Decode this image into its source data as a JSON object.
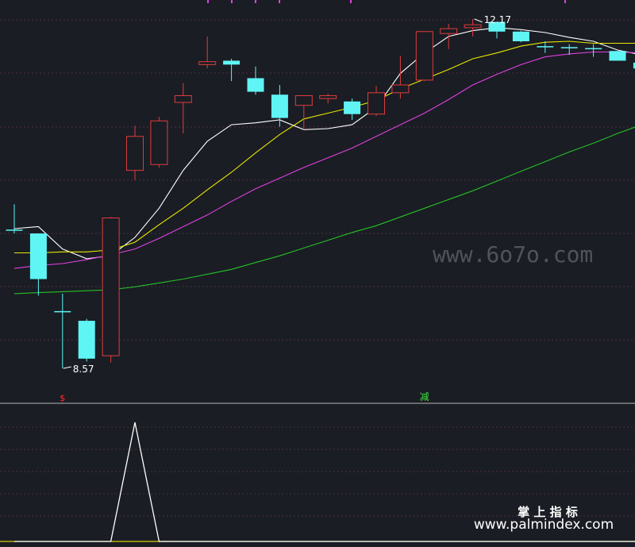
{
  "chart_data": [
    {
      "type": "candlestick",
      "ylim": [
        8.3,
        12.3
      ],
      "grid": "dotted horizontal",
      "candles": [
        {
          "o": 10.0,
          "h": 10.26,
          "l": 9.96,
          "c": 10.0,
          "dir": "flat"
        },
        {
          "o": 9.96,
          "h": 9.96,
          "l": 9.32,
          "c": 9.49,
          "dir": "down"
        },
        {
          "o": 9.16,
          "h": 9.34,
          "l": 8.57,
          "c": 9.16,
          "dir": "flat"
        },
        {
          "o": 9.06,
          "h": 9.08,
          "l": 8.64,
          "c": 8.67,
          "dir": "down"
        },
        {
          "o": 8.7,
          "h": 10.13,
          "l": 8.63,
          "c": 10.12,
          "dir": "up"
        },
        {
          "o": 10.61,
          "h": 11.07,
          "l": 10.51,
          "c": 10.96,
          "dir": "up"
        },
        {
          "o": 10.67,
          "h": 11.16,
          "l": 10.64,
          "c": 11.12,
          "dir": "up"
        },
        {
          "o": 11.31,
          "h": 11.51,
          "l": 10.99,
          "c": 11.38,
          "dir": "up"
        },
        {
          "o": 11.7,
          "h": 11.99,
          "l": 11.66,
          "c": 11.73,
          "dir": "up"
        },
        {
          "o": 11.74,
          "h": 11.76,
          "l": 11.53,
          "c": 11.7,
          "dir": "down"
        },
        {
          "o": 11.56,
          "h": 11.68,
          "l": 11.39,
          "c": 11.42,
          "dir": "down"
        },
        {
          "o": 11.39,
          "h": 11.49,
          "l": 11.06,
          "c": 11.15,
          "dir": "down"
        },
        {
          "o": 11.28,
          "h": 11.38,
          "l": 11.03,
          "c": 11.38,
          "dir": "up"
        },
        {
          "o": 11.35,
          "h": 11.4,
          "l": 11.3,
          "c": 11.38,
          "dir": "up"
        },
        {
          "o": 11.32,
          "h": 11.35,
          "l": 11.13,
          "c": 11.19,
          "dir": "down"
        },
        {
          "o": 11.19,
          "h": 11.48,
          "l": 11.17,
          "c": 11.41,
          "dir": "up"
        },
        {
          "o": 11.41,
          "h": 11.79,
          "l": 11.35,
          "c": 11.49,
          "dir": "up"
        },
        {
          "o": 11.54,
          "h": 12.04,
          "l": 11.53,
          "c": 12.04,
          "dir": "up"
        },
        {
          "o": 12.02,
          "h": 12.12,
          "l": 11.86,
          "c": 12.07,
          "dir": "up"
        },
        {
          "o": 12.08,
          "h": 12.17,
          "l": 11.99,
          "c": 12.11,
          "dir": "up"
        },
        {
          "o": 12.14,
          "h": 12.14,
          "l": 11.97,
          "c": 12.04,
          "dir": "down"
        },
        {
          "o": 12.04,
          "h": 12.05,
          "l": 11.93,
          "c": 11.94,
          "dir": "down"
        },
        {
          "o": 11.89,
          "h": 11.94,
          "l": 11.82,
          "c": 11.88,
          "dir": "flat"
        },
        {
          "o": 11.88,
          "h": 11.91,
          "l": 11.8,
          "c": 11.88,
          "dir": "flat"
        },
        {
          "o": 11.87,
          "h": 11.91,
          "l": 11.78,
          "c": 11.87,
          "dir": "down"
        },
        {
          "o": 11.84,
          "h": 11.84,
          "l": 11.74,
          "c": 11.74,
          "dir": "down"
        },
        {
          "o": 11.72,
          "h": 11.72,
          "l": 11.65,
          "c": 11.66,
          "dir": "down"
        }
      ],
      "moving_averages": [
        {
          "color": "#ffffff",
          "values": [
            10.01,
            10.03,
            9.8,
            9.7,
            9.73,
            9.92,
            10.22,
            10.61,
            10.91,
            11.08,
            11.1,
            11.13,
            11.03,
            11.04,
            11.08,
            11.26,
            11.61,
            11.82,
            11.99,
            12.05,
            12.08,
            12.06,
            12.03,
            11.98,
            11.94,
            11.85,
            11.8
          ]
        },
        {
          "color": "#e8e800",
          "values": [
            9.76,
            9.76,
            9.77,
            9.77,
            9.79,
            9.87,
            10.05,
            10.22,
            10.41,
            10.59,
            10.79,
            10.98,
            11.14,
            11.2,
            11.26,
            11.33,
            11.45,
            11.55,
            11.65,
            11.76,
            11.82,
            11.89,
            11.93,
            11.94,
            11.92,
            11.92,
            11.92
          ]
        },
        {
          "color": "#e040e0",
          "values": [
            9.6,
            9.63,
            9.65,
            9.69,
            9.74,
            9.8,
            9.91,
            10.03,
            10.15,
            10.29,
            10.42,
            10.53,
            10.64,
            10.74,
            10.84,
            10.96,
            11.08,
            11.2,
            11.34,
            11.49,
            11.6,
            11.7,
            11.78,
            11.81,
            11.83,
            11.83,
            11.82
          ]
        },
        {
          "color": "#26c026",
          "values": [
            9.34,
            9.35,
            9.36,
            9.37,
            9.38,
            9.41,
            9.45,
            9.49,
            9.54,
            9.59,
            9.66,
            9.73,
            9.81,
            9.89,
            9.97,
            10.04,
            10.13,
            10.22,
            10.31,
            10.4,
            10.5,
            10.6,
            10.7,
            10.8,
            10.89,
            10.99,
            11.08
          ]
        }
      ],
      "annotations": [
        {
          "text": "12.17",
          "candle": 19,
          "value": 12.17
        },
        {
          "text": "8.57",
          "candle": 2,
          "value": 8.57
        }
      ],
      "signals": [
        {
          "text": "$",
          "candle": 2,
          "color": "#ff3030"
        },
        {
          "text": "减",
          "candle": 17,
          "color": "#40e040"
        }
      ]
    },
    {
      "type": "line",
      "ylim": [
        0,
        1
      ],
      "series": [
        {
          "color": "#ffffff",
          "values": [
            0,
            0,
            0,
            0,
            0,
            1,
            0,
            0,
            0,
            0,
            0,
            0,
            0,
            0,
            0,
            0,
            0,
            0,
            0,
            0,
            0,
            0,
            0,
            0,
            0,
            0,
            0
          ]
        }
      ]
    }
  ],
  "watermarks": {
    "site_big": "www.6o7o.com",
    "brand_cn": "掌 上 指 标",
    "brand_url": "www.palmindex.com"
  },
  "colors": {
    "background": "#1a1d24",
    "up": "#e03c3c",
    "down": "#5ff5f5",
    "grid": "#4a3040",
    "separator": "#b8b8b8"
  }
}
